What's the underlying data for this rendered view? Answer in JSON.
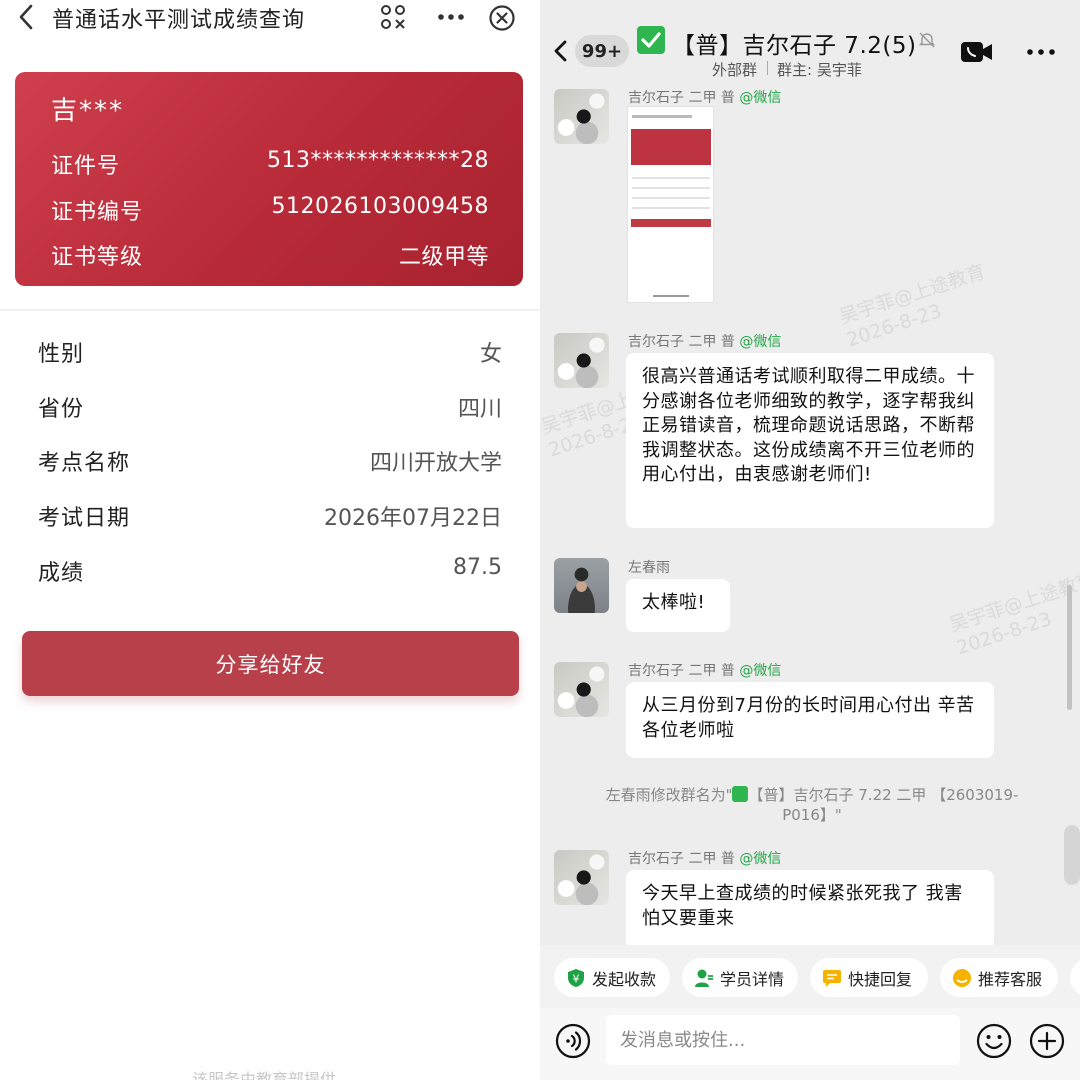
{
  "left": {
    "title": "普通话水平测试成绩查询",
    "card": {
      "name": "吉***",
      "rows": [
        {
          "label": "证件号",
          "value": "513*************28"
        },
        {
          "label": "证书编号",
          "value": "512026103009458"
        },
        {
          "label": "证书等级",
          "value": "二级甲等"
        }
      ]
    },
    "info": [
      {
        "label": "性别",
        "value": "女"
      },
      {
        "label": "省份",
        "value": "四川"
      },
      {
        "label": "考点名称",
        "value": "四川开放大学"
      },
      {
        "label": "考试日期",
        "value": "2026年07月22日"
      },
      {
        "label": "成绩",
        "value": "87.5"
      }
    ],
    "share_label": "分享给好友",
    "footer": "该服务由教育部提供"
  },
  "right": {
    "unread_badge": "99+",
    "group_title": "【普】吉尔石子 7.2",
    "member_count": "(5)",
    "external_label": "外部群",
    "owner_label": "群主: 吴宇菲",
    "messages": [
      {
        "sender": "吉尔石子 二甲 普",
        "via": "@微信",
        "type": "image"
      },
      {
        "sender": "吉尔石子 二甲 普",
        "via": "@微信",
        "text": "很高兴普通话考试顺利取得二甲成绩。十分感谢各位老师细致的教学，逐字帮我纠正易错读音，梳理命题说话思路，不断帮我调整状态。这份成绩离不开三位老师的用心付出，由衷感谢老师们!"
      },
      {
        "sender": "左春雨",
        "via": "",
        "text": "太棒啦!"
      },
      {
        "sender": "吉尔石子 二甲 普",
        "via": "@微信",
        "text": "从三月份到7月份的长时间用心付出 辛苦各位老师啦"
      },
      {
        "sender": "吉尔石子 二甲 普",
        "via": "@微信",
        "text": "今天早上查成绩的时候紧张死我了 我害怕又要重来"
      }
    ],
    "system_msg": {
      "prefix": "左春雨修改群名为\"",
      "suffix": "【普】吉尔石子 7.22 二甲 【2603019-P016】\""
    },
    "watermark": {
      "line1": "吴宇菲@上途教育",
      "line2": "2026-8-23"
    },
    "quick_actions": [
      {
        "label": "发起收款",
        "icon": "payment-icon",
        "color": "#1fa245"
      },
      {
        "label": "学员详情",
        "icon": "student-icon",
        "color": "#1fa245"
      },
      {
        "label": "快捷回复",
        "icon": "quick-reply-icon",
        "color": "#f5b300"
      },
      {
        "label": "推荐客服",
        "icon": "customer-service-icon",
        "color": "#f5b300"
      }
    ],
    "input_placeholder": "发消息或按住..."
  },
  "colors": {
    "card_red": "#bd2f3d",
    "share_button": "#b8404a",
    "wechat_green": "#22a646"
  }
}
